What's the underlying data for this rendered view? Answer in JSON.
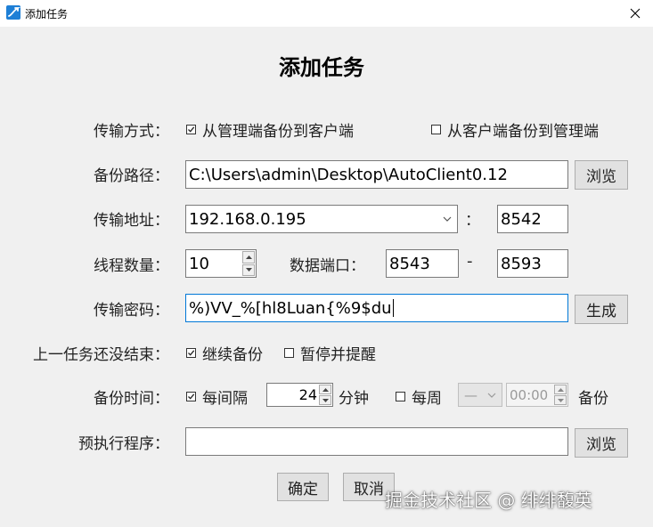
{
  "window": {
    "title": "添加任务"
  },
  "page_title": "添加任务",
  "transfer_mode": {
    "label": "传输方式：",
    "options": [
      {
        "label": "从管理端备份到客户端",
        "checked": true
      },
      {
        "label": "从客户端备份到管理端",
        "checked": false
      }
    ]
  },
  "backup_path": {
    "label": "备份路径：",
    "value": "C:\\Users\\admin\\Desktop\\AutoClient0.12",
    "browse_label": "浏览"
  },
  "transfer_address": {
    "label": "传输地址：",
    "ip": "192.168.0.195",
    "colon": "：",
    "port": "8542"
  },
  "threads": {
    "label": "线程数量：",
    "value": "10"
  },
  "data_port": {
    "label": "数据端口：",
    "from": "8543",
    "dash": "-",
    "to": "8593"
  },
  "password": {
    "label": "传输密码：",
    "value": "%)VV_%[hl8Luan{%9$du",
    "generate_label": "生成"
  },
  "unfinished": {
    "label": "上一任务还没结束：",
    "options": [
      {
        "label": "继续备份",
        "checked": true
      },
      {
        "label": "暂停并提醒",
        "checked": false
      }
    ]
  },
  "backup_time": {
    "label": "备份时间：",
    "interval_label": "每间隔",
    "interval_checked": true,
    "interval_value": "24",
    "minute_label": "分钟",
    "weekly_label": "每周",
    "weekly_checked": false,
    "weekday_value": "—",
    "time_value": "00:00",
    "suffix": "备份"
  },
  "pre_exec": {
    "label": "预执行程序：",
    "value": "",
    "browse_label": "浏览"
  },
  "buttons": {
    "ok": "确定",
    "cancel": "取消"
  },
  "watermark": "掘金技术社区 @ 绯绯馥英"
}
